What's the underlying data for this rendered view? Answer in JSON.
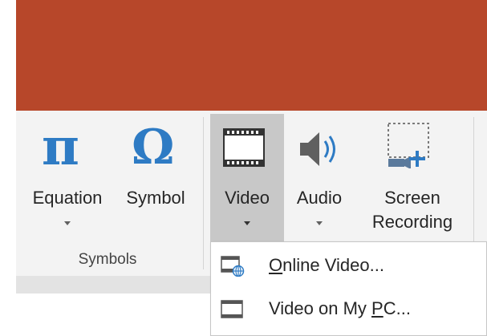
{
  "ribbon": {
    "buttons": {
      "equation": {
        "glyph": "π",
        "label": "Equation",
        "icon": "pi-icon"
      },
      "symbol": {
        "glyph": "Ω",
        "label": "Symbol",
        "icon": "omega-icon"
      },
      "video": {
        "label": "Video",
        "icon": "film-icon"
      },
      "audio": {
        "label": "Audio",
        "icon": "speaker-icon"
      },
      "screen_recording": {
        "label_line1": "Screen",
        "label_line2": "Recording",
        "icon": "screen-recording-icon"
      }
    },
    "groups": {
      "symbols": "Symbols"
    }
  },
  "video_menu": {
    "items": [
      {
        "pre": "",
        "accel": "O",
        "post": "nline Video...",
        "icon": "online-video-icon"
      },
      {
        "pre": "Video on My ",
        "accel": "P",
        "post": "C...",
        "icon": "video-file-icon"
      }
    ]
  },
  "colors": {
    "title_bar": "#b7472a",
    "ribbon": "#f3f3f3",
    "icon_blue": "#2e7bc4",
    "selected_button": "#c8c8c8"
  }
}
